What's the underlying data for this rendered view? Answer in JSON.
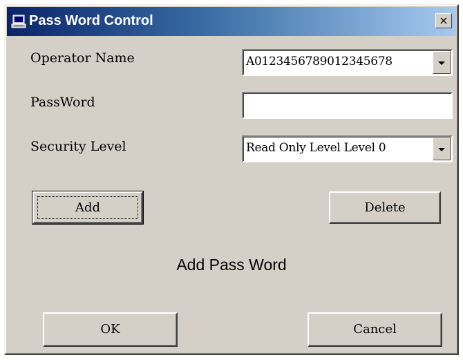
{
  "window": {
    "title": "Pass Word Control",
    "close_glyph": "×"
  },
  "form": {
    "operator_name_label": "Operator Name",
    "operator_name_value": "A0123456789012345678",
    "password_label": "PassWord",
    "password_value": "",
    "security_level_label": "Security Level",
    "security_level_value": "Read Only Level Level 0"
  },
  "buttons": {
    "add_label": "Add",
    "delete_label": "Delete",
    "ok_label": "OK",
    "cancel_label": "Cancel"
  },
  "status": {
    "message": "Add Pass Word"
  },
  "icons": {
    "title_icon": "computer-icon",
    "dropdown_icon": "chevron-down-icon"
  },
  "colors": {
    "title_gradient_start": "#0a246a",
    "title_gradient_end": "#a6caf0",
    "face": "#d4d0c8"
  }
}
